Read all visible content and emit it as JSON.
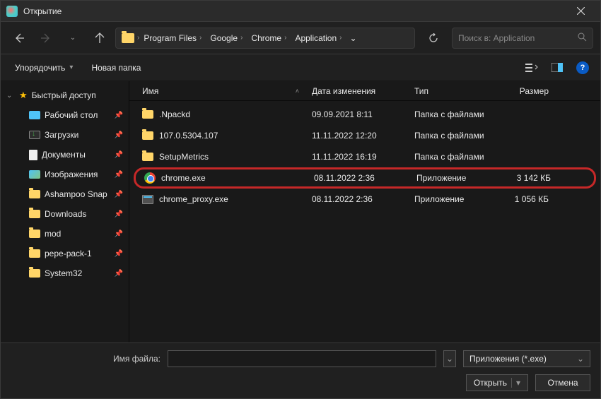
{
  "title": "Открытие",
  "breadcrumbs": [
    "Program Files",
    "Google",
    "Chrome",
    "Application"
  ],
  "search_placeholder": "Поиск в: Application",
  "toolbar": {
    "organize": "Упорядочить",
    "new_folder": "Новая папка"
  },
  "sidebar": {
    "quick_access": "Быстрый доступ",
    "items": [
      {
        "label": "Рабочий стол",
        "icon": "desktop"
      },
      {
        "label": "Загрузки",
        "icon": "downloads"
      },
      {
        "label": "Документы",
        "icon": "document"
      },
      {
        "label": "Изображения",
        "icon": "pictures"
      },
      {
        "label": "Ashampoo Snap",
        "icon": "folder"
      },
      {
        "label": "Downloads",
        "icon": "folder"
      },
      {
        "label": "mod",
        "icon": "folder"
      },
      {
        "label": "pepe-pack-1",
        "icon": "folder"
      },
      {
        "label": "System32",
        "icon": "folder"
      }
    ]
  },
  "columns": {
    "name": "Имя",
    "date": "Дата изменения",
    "type": "Тип",
    "size": "Размер"
  },
  "files": [
    {
      "name": ".Npackd",
      "date": "09.09.2021 8:11",
      "type": "Папка с файлами",
      "size": "",
      "icon": "folder",
      "hl": false
    },
    {
      "name": "107.0.5304.107",
      "date": "11.11.2022 12:20",
      "type": "Папка с файлами",
      "size": "",
      "icon": "folder",
      "hl": false
    },
    {
      "name": "SetupMetrics",
      "date": "11.11.2022 16:19",
      "type": "Папка с файлами",
      "size": "",
      "icon": "folder",
      "hl": false
    },
    {
      "name": "chrome.exe",
      "date": "08.11.2022 2:36",
      "type": "Приложение",
      "size": "3 142 КБ",
      "icon": "chrome",
      "hl": true
    },
    {
      "name": "chrome_proxy.exe",
      "date": "08.11.2022 2:36",
      "type": "Приложение",
      "size": "1 056 КБ",
      "icon": "exe",
      "hl": false
    }
  ],
  "footer": {
    "filename_label": "Имя файла:",
    "filename_value": "",
    "filter": "Приложения (*.exe)",
    "open": "Открыть",
    "cancel": "Отмена"
  }
}
